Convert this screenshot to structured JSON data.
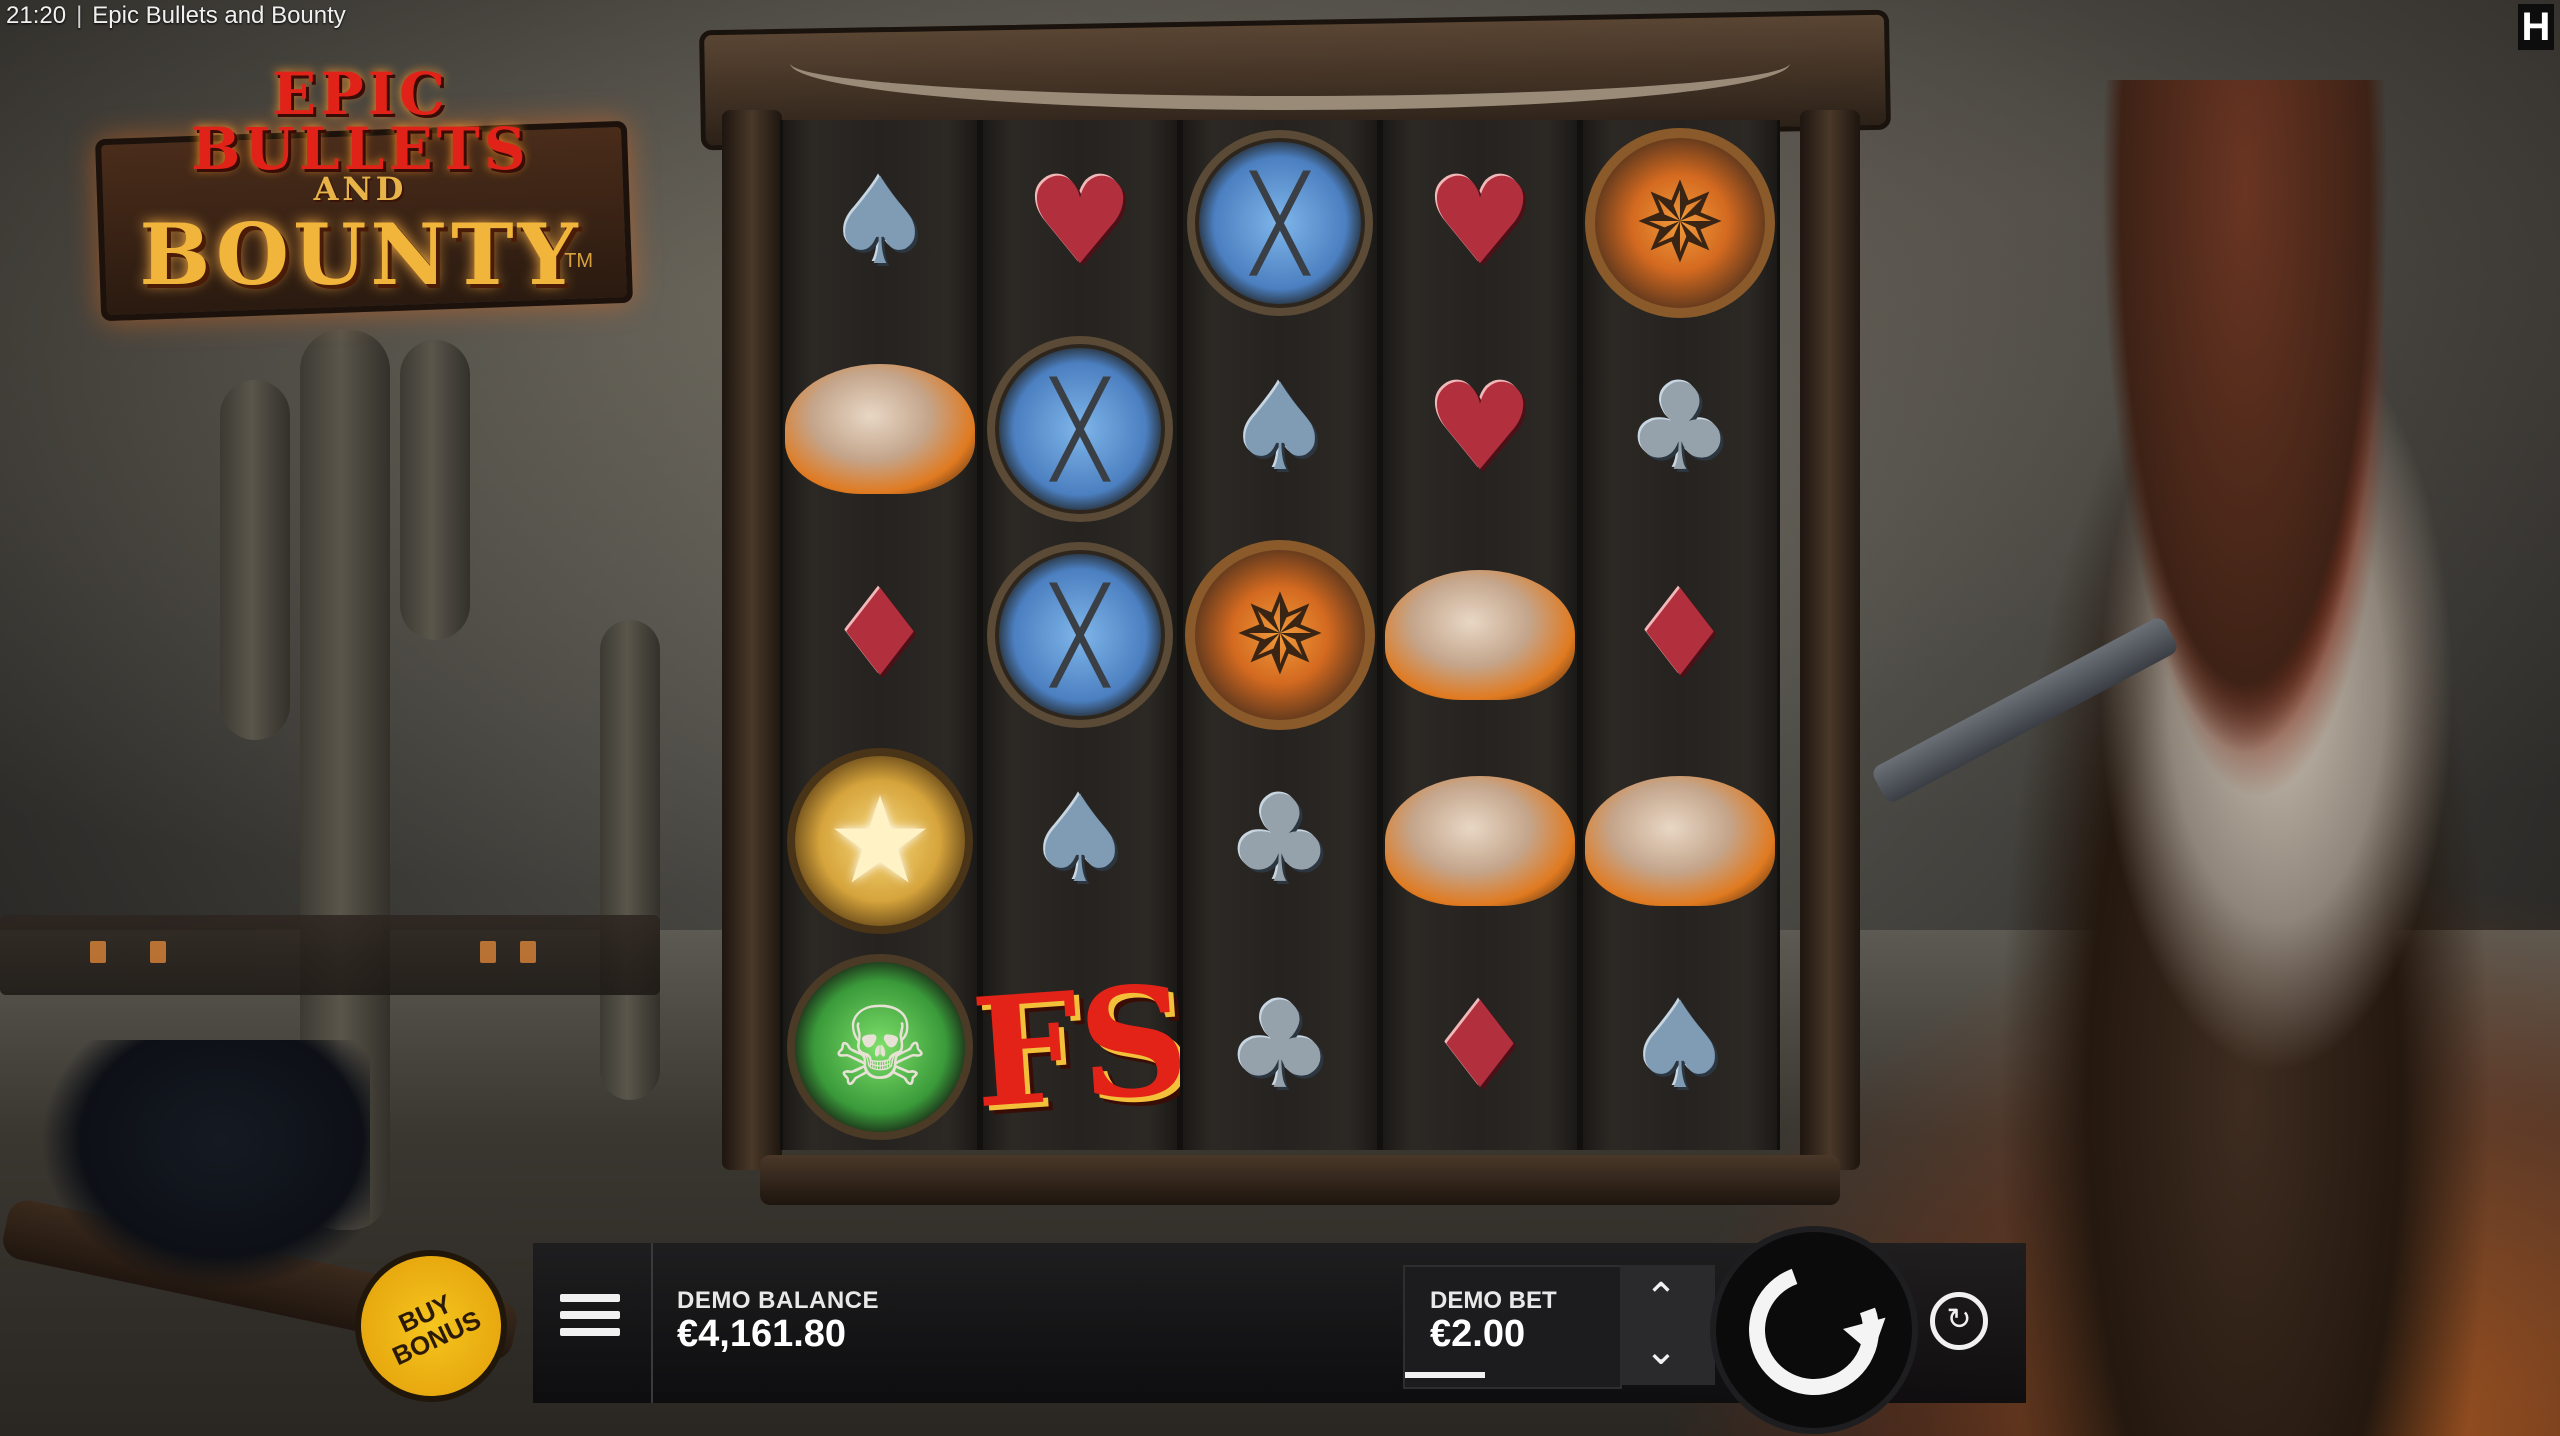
{
  "status_bar": {
    "time": "21:20",
    "separator": "|",
    "window_title": "Epic Bullets and Bounty"
  },
  "brand_icon": "H",
  "logo": {
    "line1": "EPIC",
    "line2": "BULLETS",
    "line3": "AND",
    "line4": "BOUNTY",
    "tm": "TM"
  },
  "reels": [
    [
      "spade",
      "hat",
      "diamond",
      "sheriff-star",
      "bull-skull"
    ],
    [
      "heart",
      "crossed-guns",
      "crossed-guns",
      "spade",
      "free-spins"
    ],
    [
      "crossed-guns",
      "spade",
      "wagon-wheel",
      "club",
      "club"
    ],
    [
      "heart",
      "heart",
      "hat",
      "hat",
      "diamond"
    ],
    [
      "wagon-wheel",
      "club",
      "diamond",
      "hat",
      "spade"
    ]
  ],
  "symbols": {
    "spade": "♠",
    "club": "♣",
    "heart": "♥",
    "diamond": "♦",
    "free_spins": "FS"
  },
  "controls": {
    "buy_bonus_label": "BUY BONUS",
    "balance_label": "DEMO BALANCE",
    "balance_value": "€4,161.80",
    "bet_label": "DEMO BET",
    "bet_value": "€2.00",
    "bet_up_icon": "chevron-up-icon",
    "bet_down_icon": "chevron-down-icon",
    "spin_icon": "spin-icon",
    "autoplay_icon": "autoplay-icon",
    "menu_icon": "hamburger-menu-icon"
  },
  "colors": {
    "buy_bonus": "#f6c51e",
    "suit_red": "#b2303d",
    "suit_blue": "#7f9cb4",
    "bar_bg": "#1c1c1e"
  }
}
